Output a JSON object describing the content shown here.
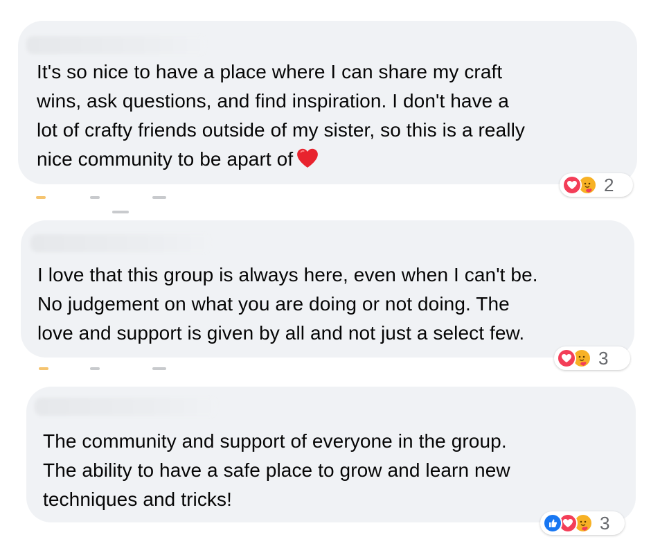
{
  "comments": [
    {
      "text": "It's so nice to have a place where I can share my craft\nwins, ask questions, and find inspiration. I don't have a\nlot of crafty friends outside of my sister, so this is a really\nnice community to be apart of",
      "trailing_emoji": "heart-emoji",
      "reactions": [
        "love",
        "care"
      ],
      "reaction_count": "2"
    },
    {
      "text": "I love that this group is always here, even when I can't be.\nNo judgement on what you are doing or not doing. The\nlove and support is given by all and not just a select few.",
      "reactions": [
        "love",
        "care"
      ],
      "reaction_count": "3"
    },
    {
      "text": "The community and support of everyone in the group.\nThe ability to have a safe place to grow and learn new\ntechniques and tricks!",
      "reactions": [
        "like",
        "love",
        "care"
      ],
      "reaction_count": "3"
    }
  ],
  "colors": {
    "bubble_bg": "#f0f2f5",
    "text": "#050505",
    "love": "#f33e58",
    "like": "#1877f2",
    "care": "#f7b125",
    "count": "#65676b"
  }
}
